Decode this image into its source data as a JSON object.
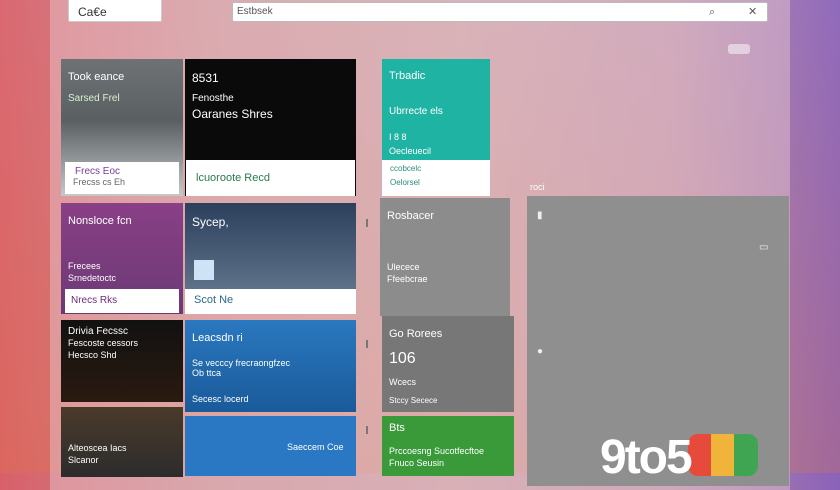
{
  "toolbar": {
    "left_button": "Ca€e",
    "search_value": "Estbsek"
  },
  "tiles": [
    {
      "title": "Took eance",
      "subtitle": "Sarsed Frel",
      "footer_line1": "Frecs Eoc",
      "footer_line2": "Frecss cs Eh",
      "color": "#6b6e70"
    },
    {
      "title": "8531",
      "subtitle": "Fenosthe",
      "subtitle2": "Oaranes Shres",
      "footer": "lcuoroote Recd",
      "color": "#0a0a0a"
    },
    {
      "title": "Trbadic",
      "subtitle": "Ubrrecte els",
      "line3": "I 8 8",
      "line4": "Oecleuecil",
      "footer_line1": "ccobcelc",
      "footer_line2": "Oelorsel",
      "color": "#1fb3a3"
    },
    {
      "title": "Nonsloce fcn",
      "subtitle": "Frecees",
      "subtitle2": "Srnedetoctc",
      "footer": "Nrecs Rks",
      "color": "#7a3c7a"
    },
    {
      "title": "Sycep,",
      "footer": "Scot Ne",
      "color": "#41566e"
    },
    {
      "title": "Rosbacer",
      "subtitle": "Ulecece",
      "subtitle2": "Ffeebcrae",
      "color": "#8c8c8c"
    },
    {
      "title": "Drivia Fecssc",
      "subtitle": "Fescoste cessors",
      "subtitle2": "Hecsco Shd",
      "color": "#121212"
    },
    {
      "title": "Leacsdn ri",
      "subtitle": "Se vecccy frecraongfzec",
      "subtitle2": "Ob ttca",
      "footer": "Secesc locerd",
      "color": "#2a7cc0"
    },
    {
      "title": "Go Rorees",
      "value": "106",
      "subtitle": "Wcecs",
      "footer": "Stccy Secece",
      "color": "#777777"
    },
    {
      "title": "Alteoscea Iacs",
      "subtitle": "Slcanor",
      "color": "#2c2c2c"
    },
    {
      "title": "Saeccem Coe",
      "color": "#2a78c4"
    },
    {
      "title": "Bts",
      "subtitle": "Prccoesng Sucotfecftoe",
      "subtitle2": "Fnuco Seusin",
      "color": "#3a9a3a"
    }
  ],
  "misc_label": "roci",
  "logo_text": "9to5"
}
